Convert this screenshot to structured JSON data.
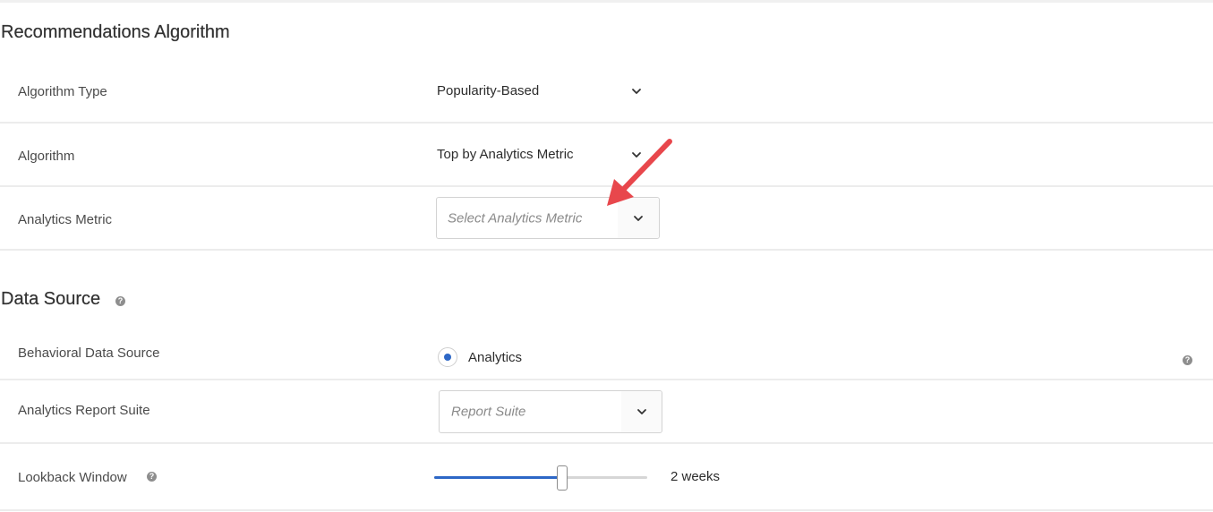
{
  "recommendations": {
    "title": "Recommendations Algorithm",
    "algorithm_type": {
      "label": "Algorithm Type",
      "value": "Popularity-Based"
    },
    "algorithm": {
      "label": "Algorithm",
      "value": "Top by Analytics Metric"
    },
    "analytics_metric": {
      "label": "Analytics Metric",
      "placeholder": "Select Analytics Metric"
    }
  },
  "data_source": {
    "title": "Data Source",
    "help_icon": "question-circle-icon",
    "behavioral": {
      "label": "Behavioral Data Source",
      "option": "Analytics",
      "selected": true
    },
    "report_suite": {
      "label": "Analytics Report Suite",
      "placeholder": "Report Suite"
    },
    "lookback": {
      "label": "Lookback Window",
      "value": "2 weeks",
      "slider_fraction": 0.6
    }
  },
  "annotation": {
    "icon": "red-arrow-icon",
    "color": "#e8474c"
  },
  "colors": {
    "accent": "#2d67c6",
    "divider": "#ececec",
    "text": "#4b4b4b"
  }
}
